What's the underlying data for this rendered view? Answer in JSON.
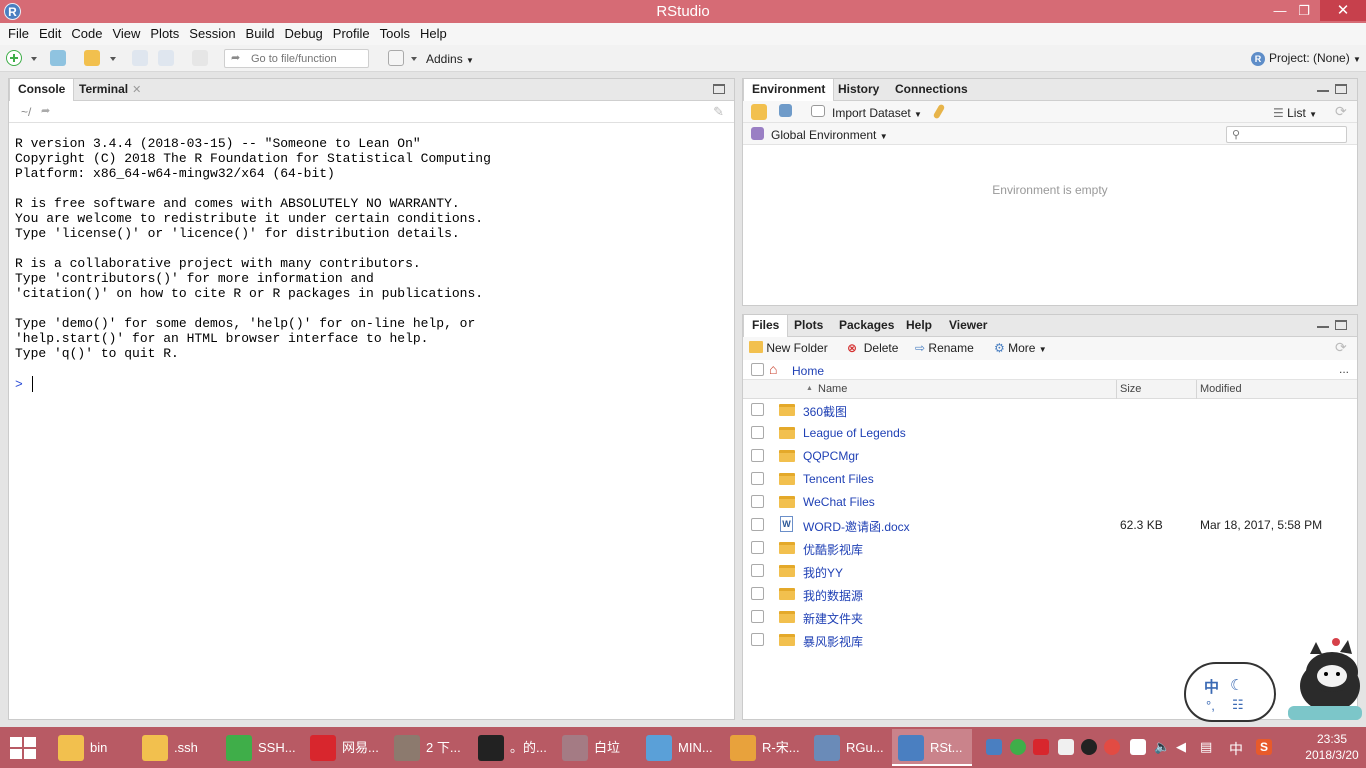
{
  "window": {
    "title": "RStudio",
    "app_icon": "R",
    "min": "—",
    "restore": "❐",
    "close": "✕"
  },
  "menu": [
    "File",
    "Edit",
    "Code",
    "View",
    "Plots",
    "Session",
    "Build",
    "Debug",
    "Profile",
    "Tools",
    "Help"
  ],
  "toolbar": {
    "goto_placeholder": "Go to file/function",
    "addins": "Addins",
    "project": "Project: (None)"
  },
  "console_pane": {
    "tabs": [
      "Console",
      "Terminal"
    ],
    "path": "~/",
    "output": "R version 3.4.4 (2018-03-15) -- \"Someone to Lean On\"\nCopyright (C) 2018 The R Foundation for Statistical Computing\nPlatform: x86_64-w64-mingw32/x64 (64-bit)\n\nR is free software and comes with ABSOLUTELY NO WARRANTY.\nYou are welcome to redistribute it under certain conditions.\nType 'license()' or 'licence()' for distribution details.\n\nR is a collaborative project with many contributors.\nType 'contributors()' for more information and\n'citation()' on how to cite R or R packages in publications.\n\nType 'demo()' for some demos, 'help()' for on-line help, or\n'help.start()' for an HTML browser interface to help.\nType 'q()' to quit R.",
    "prompt": ">"
  },
  "env_pane": {
    "tabs": [
      "Environment",
      "History",
      "Connections"
    ],
    "import_label": "Import Dataset",
    "list_label": "List",
    "scope": "Global Environment",
    "empty_message": "Environment is empty"
  },
  "files_pane": {
    "tabs": [
      "Files",
      "Plots",
      "Packages",
      "Help",
      "Viewer"
    ],
    "actions": {
      "new_folder": "New Folder",
      "delete": "Delete",
      "rename": "Rename",
      "more": "More"
    },
    "breadcrumb": "Home",
    "more_dots": "...",
    "columns": {
      "name": "Name",
      "size": "Size",
      "modified": "Modified",
      "sort_arrow": "▲"
    },
    "rows": [
      {
        "name": "360截图",
        "type": "folder",
        "size": "",
        "modified": ""
      },
      {
        "name": "League of Legends",
        "type": "folder",
        "size": "",
        "modified": ""
      },
      {
        "name": "QQPCMgr",
        "type": "folder",
        "size": "",
        "modified": ""
      },
      {
        "name": "Tencent Files",
        "type": "folder",
        "size": "",
        "modified": ""
      },
      {
        "name": "WeChat Files",
        "type": "folder",
        "size": "",
        "modified": ""
      },
      {
        "name": "WORD-邀请函.docx",
        "type": "docx",
        "size": "62.3 KB",
        "modified": "Mar 18, 2017, 5:58 PM"
      },
      {
        "name": "优酷影视库",
        "type": "folder",
        "size": "",
        "modified": ""
      },
      {
        "name": "我的YY",
        "type": "folder",
        "size": "",
        "modified": ""
      },
      {
        "name": "我的数据源",
        "type": "folder",
        "size": "",
        "modified": ""
      },
      {
        "name": "新建文件夹",
        "type": "folder",
        "size": "",
        "modified": ""
      },
      {
        "name": "暴风影视库",
        "type": "folder",
        "size": "",
        "modified": ""
      }
    ]
  },
  "taskbar": {
    "tasks": [
      {
        "label": "bin",
        "color": "#f2c04e"
      },
      {
        "label": ".ssh",
        "color": "#f2c04e"
      },
      {
        "label": "SSH...",
        "color": "#3fae49"
      },
      {
        "label": "网易...",
        "color": "#d8262d"
      },
      {
        "label": "2 下...",
        "color": "#8c7a6e"
      },
      {
        "label": "。的...",
        "color": "#222222"
      },
      {
        "label": "白垃",
        "color": "#a47b84"
      },
      {
        "label": "MIN...",
        "color": "#5aa0d8"
      },
      {
        "label": "R-宋...",
        "color": "#e8a23c"
      },
      {
        "label": "RGu...",
        "color": "#6a8bb8"
      },
      {
        "label": "RSt...",
        "color": "#4a7fc1"
      }
    ],
    "ime": "中",
    "time": "23:35",
    "date": "2018/3/20"
  },
  "ime_badge": {
    "zh": "中",
    "moon": "☾",
    "dot": "°,",
    "shirt": "☷"
  }
}
